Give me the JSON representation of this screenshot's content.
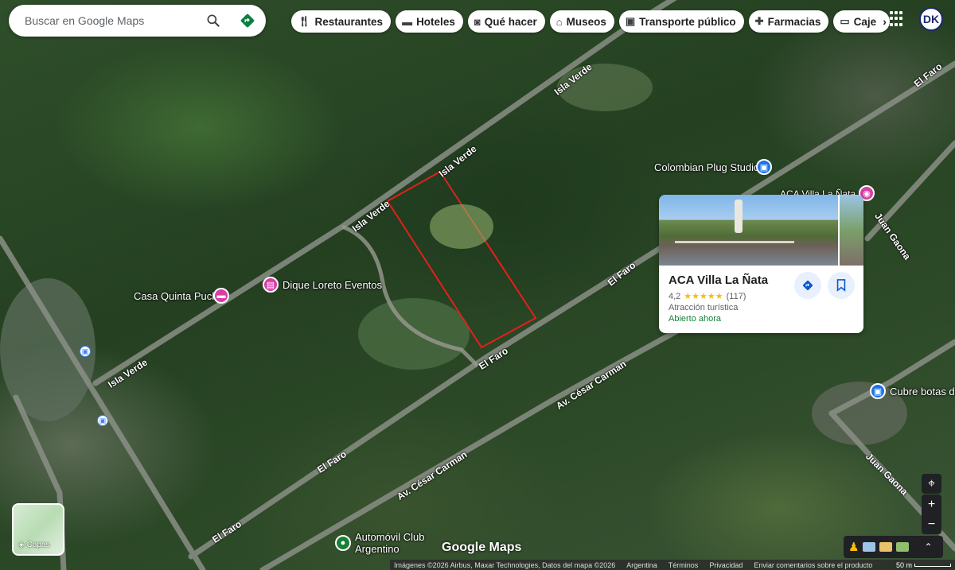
{
  "search": {
    "placeholder": "Buscar en Google Maps"
  },
  "chips": [
    {
      "label": "Restaurantes",
      "icon": "fork-knife-icon"
    },
    {
      "label": "Hoteles",
      "icon": "bed-icon"
    },
    {
      "label": "Qué hacer",
      "icon": "camera-icon"
    },
    {
      "label": "Museos",
      "icon": "museum-icon"
    },
    {
      "label": "Transporte público",
      "icon": "transit-icon"
    },
    {
      "label": "Farmacias",
      "icon": "pharmacy-icon"
    },
    {
      "label": "Caje",
      "icon": "atm-icon"
    }
  ],
  "account": {
    "initials": "DK"
  },
  "roads": {
    "isla_verde_1": "Isla Verde",
    "isla_verde_2": "Isla Verde",
    "isla_verde_3": "Isla Verde",
    "isla_verde_4": "Isla Verde",
    "el_faro_1": "El Faro",
    "el_faro_2": "El Faro",
    "el_faro_3": "El Faro",
    "el_faro_4": "El Faro",
    "el_faro_5": "El Faro",
    "cesar_carman_1": "Av. César Carman",
    "cesar_carman_2": "Av. César Carman",
    "juan_gaona_1": "Juan Gaona",
    "juan_gaona_2": "Juan Gaona"
  },
  "pois": {
    "colombian_plug": "Colombian Plug Studio",
    "aca_villa_pin": "ACA Villa La Ñata",
    "dique_loreto": "Dique Loreto Eventos",
    "casa_quinta": "Casa Quinta Puck",
    "cubre_botas": "Cubre botas de",
    "automovil_club": "Automóvil Club Argentino"
  },
  "card": {
    "title": "ACA Villa La Ñata",
    "rating": "4,2",
    "stars": "★★★★★",
    "reviews": "(117)",
    "category": "Atracción turística",
    "status": "Abierto ahora",
    "status_color": "#188038"
  },
  "layers": {
    "label": "Capas"
  },
  "brand": "Google Maps",
  "footer": {
    "imagery": "Imágenes ©2026 Airbus, Maxar Technologies, Datos del mapa ©2026",
    "country": "Argentina",
    "terms": "Términos",
    "privacy": "Privacidad",
    "feedback": "Enviar comentarios sobre el producto",
    "scale": "50 m"
  },
  "colors": {
    "boundary": "#e0211b",
    "accent": "#1a73e8",
    "chip_bg": "#ffffff"
  }
}
